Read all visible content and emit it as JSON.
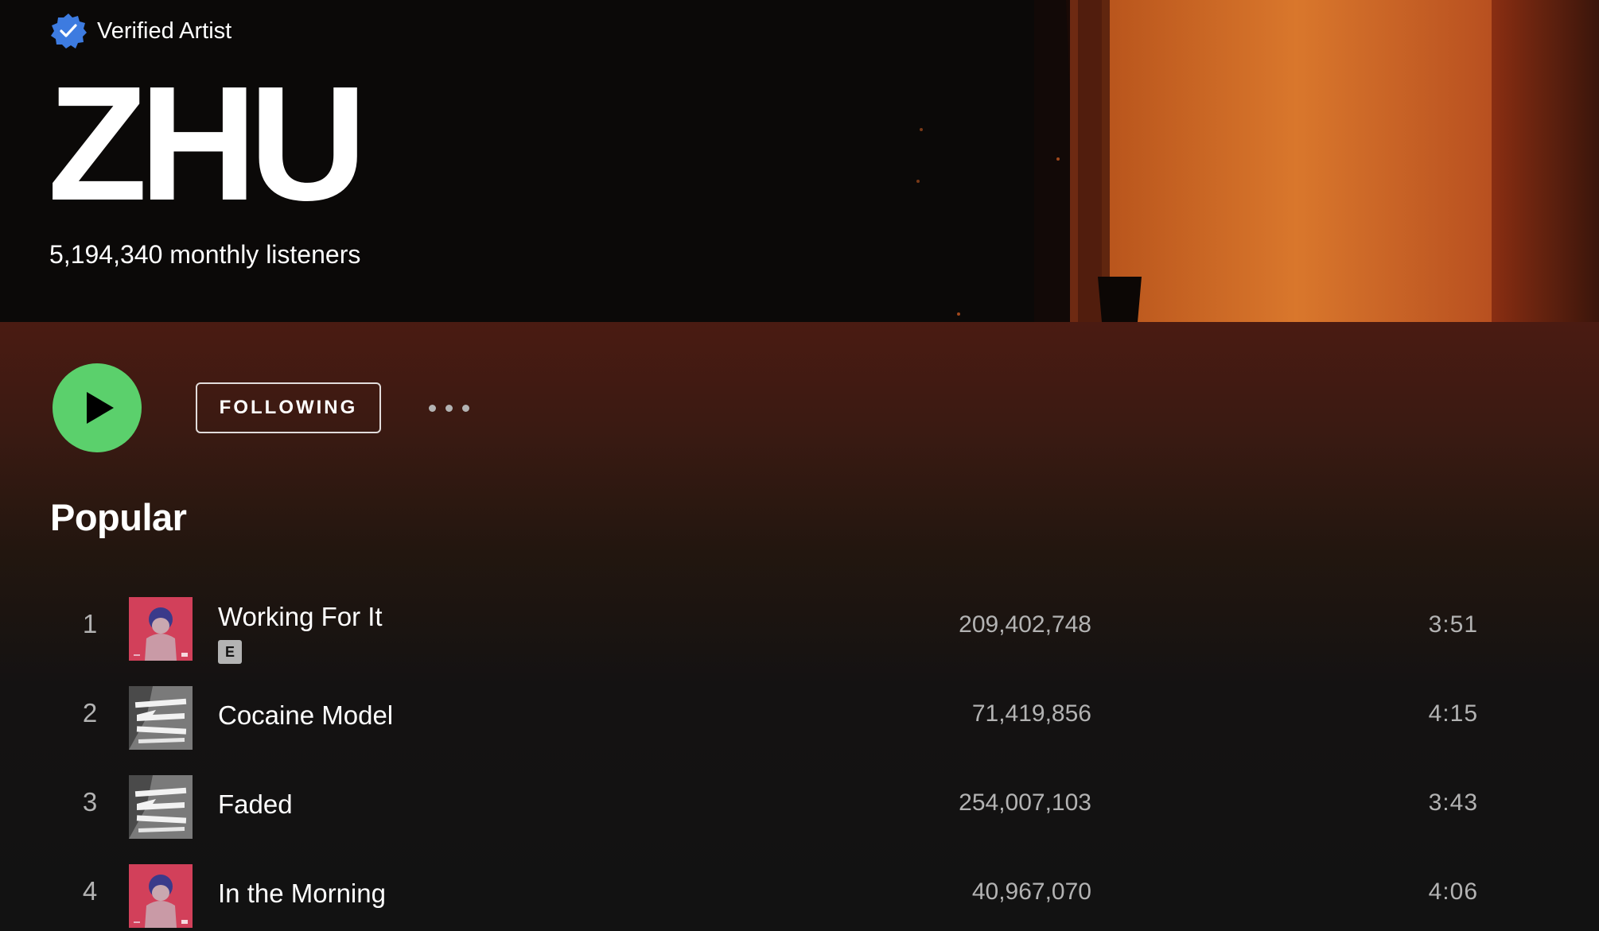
{
  "hero": {
    "verified_label": "Verified Artist",
    "artist_name": "ZHU",
    "monthly_listeners": "5,194,340 monthly listeners"
  },
  "actions": {
    "follow_label": "FOLLOWING"
  },
  "popular": {
    "title": "Popular",
    "tracks": [
      {
        "number": "1",
        "title": "Working For It",
        "explicit": true,
        "explicit_label": "E",
        "plays": "209,402,748",
        "duration": "3:51",
        "art": "pink-baby-cover"
      },
      {
        "number": "2",
        "title": "Cocaine Model",
        "explicit": false,
        "plays": "71,419,856",
        "duration": "4:15",
        "art": "zhu-logo-cover"
      },
      {
        "number": "3",
        "title": "Faded",
        "explicit": false,
        "plays": "254,007,103",
        "duration": "3:43",
        "art": "zhu-logo-cover"
      },
      {
        "number": "4",
        "title": "In the Morning",
        "explicit": false,
        "plays": "40,967,070",
        "duration": "4:06",
        "art": "pink-baby-cover"
      }
    ]
  },
  "colors": {
    "accent_green": "#5bd06c",
    "verified_blue": "#3d7be0",
    "muted_text": "#b3b3b3"
  }
}
